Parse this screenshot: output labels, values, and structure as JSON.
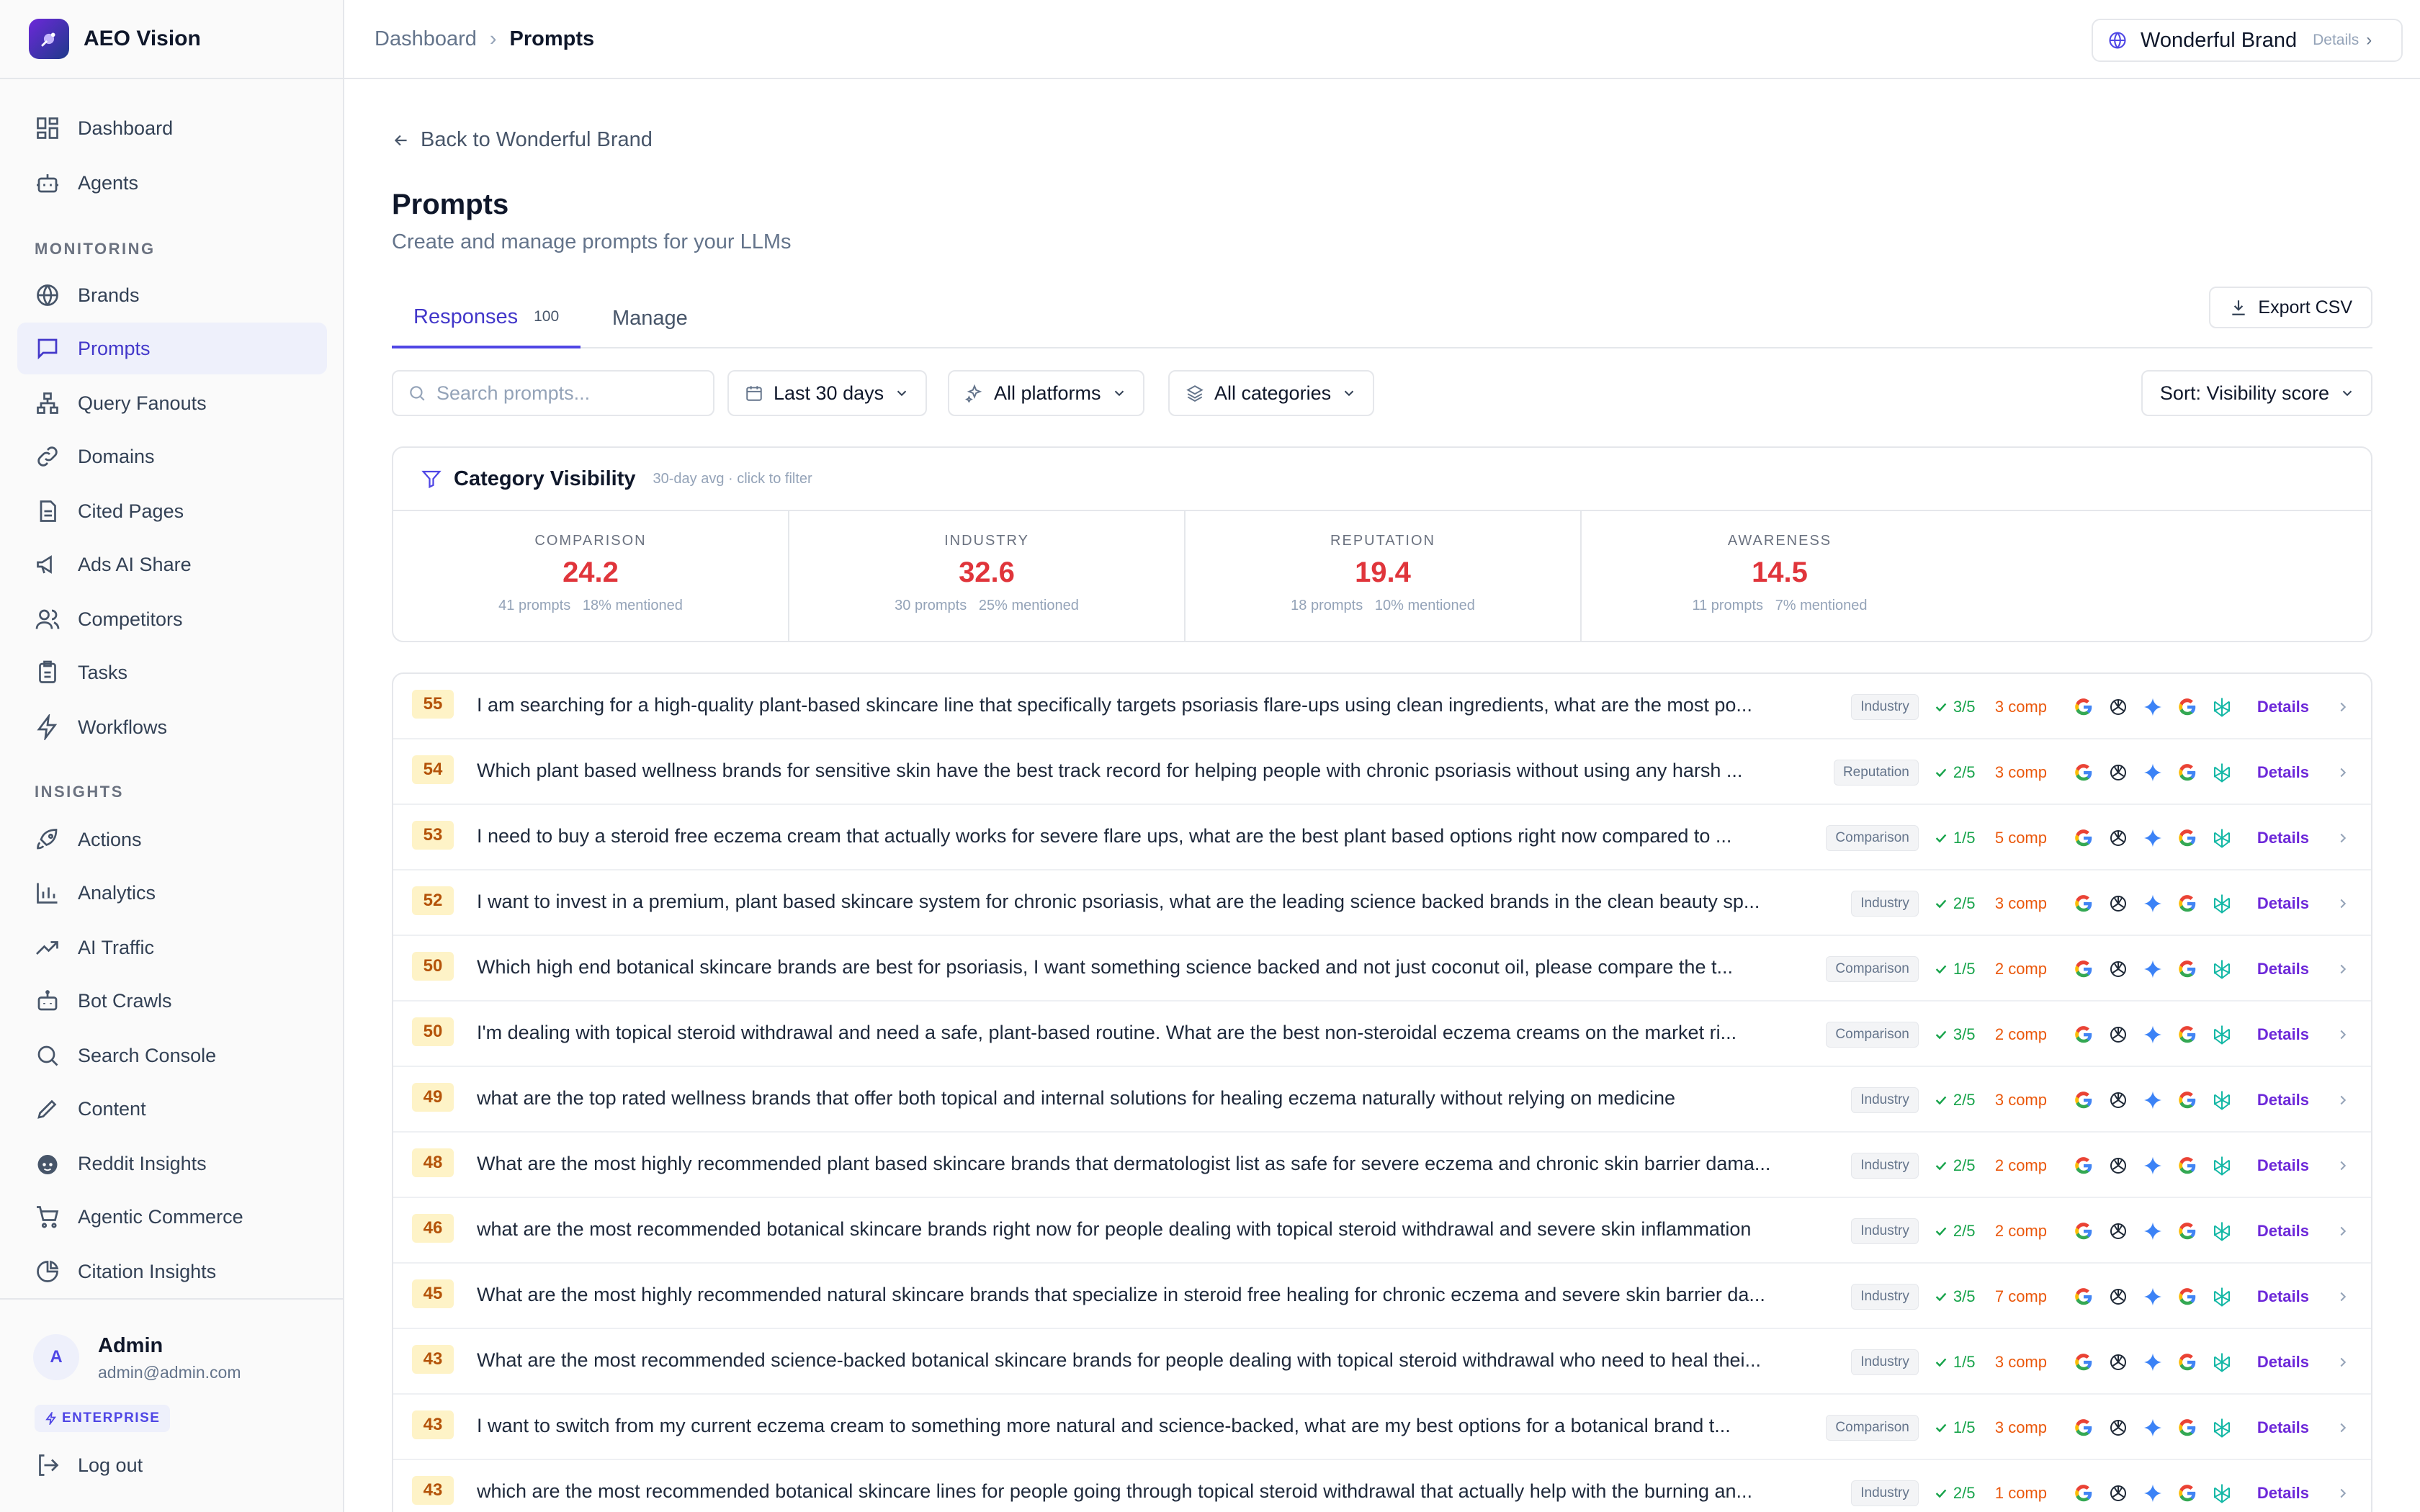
{
  "app": {
    "name": "AEO Vision"
  },
  "sidebar": {
    "top_items": [
      {
        "label": "Dashboard",
        "icon": "dashboard-icon"
      },
      {
        "label": "Agents",
        "icon": "bot-icon"
      }
    ],
    "monitoring_title": "MONITORING",
    "monitoring_items": [
      {
        "label": "Brands",
        "icon": "globe-icon"
      },
      {
        "label": "Prompts",
        "icon": "message-icon",
        "active": true
      },
      {
        "label": "Query Fanouts",
        "icon": "network-icon"
      },
      {
        "label": "Domains",
        "icon": "link-icon"
      },
      {
        "label": "Cited Pages",
        "icon": "file-icon"
      },
      {
        "label": "Ads AI Share",
        "icon": "megaphone-icon"
      },
      {
        "label": "Competitors",
        "icon": "users-icon"
      },
      {
        "label": "Tasks",
        "icon": "clipboard-icon"
      },
      {
        "label": "Workflows",
        "icon": "zap-icon"
      }
    ],
    "insights_title": "INSIGHTS",
    "insights_items": [
      {
        "label": "Actions",
        "icon": "rocket-icon"
      },
      {
        "label": "Analytics",
        "icon": "bar-chart-icon"
      },
      {
        "label": "AI Traffic",
        "icon": "trending-up-icon"
      },
      {
        "label": "Bot Crawls",
        "icon": "robot-icon"
      },
      {
        "label": "Search Console",
        "icon": "search-icon"
      },
      {
        "label": "Content",
        "icon": "pencil-icon"
      },
      {
        "label": "Reddit Insights",
        "icon": "reddit-icon"
      },
      {
        "label": "Agentic Commerce",
        "icon": "cart-icon"
      },
      {
        "label": "Citation Insights",
        "icon": "pie-chart-icon"
      }
    ],
    "user": {
      "initial": "A",
      "name": "Admin",
      "email": "admin@admin.com",
      "plan": "ENTERPRISE"
    },
    "logout_label": "Log out"
  },
  "header": {
    "breadcrumb": [
      "Dashboard",
      "Prompts"
    ],
    "brand": {
      "name": "Wonderful Brand",
      "details_label": "Details"
    }
  },
  "page": {
    "back_label": "Back to Wonderful Brand",
    "title": "Prompts",
    "subtitle": "Create and manage prompts for your LLMs",
    "tabs": [
      {
        "label": "Responses",
        "count": "100",
        "active": true
      },
      {
        "label": "Manage"
      }
    ],
    "export_label": "Export CSV",
    "search_placeholder": "Search prompts...",
    "filters": {
      "date": "Last 30 days",
      "platforms": "All platforms",
      "categories": "All categories",
      "sort": "Sort: Visibility score"
    }
  },
  "category_visibility": {
    "title": "Category Visibility",
    "subtitle": "30-day avg · click to filter",
    "categories": [
      {
        "label": "COMPARISON",
        "value": "24.2",
        "prompts": "41 prompts",
        "mentioned": "18% mentioned"
      },
      {
        "label": "INDUSTRY",
        "value": "32.6",
        "prompts": "30 prompts",
        "mentioned": "25% mentioned"
      },
      {
        "label": "REPUTATION",
        "value": "19.4",
        "prompts": "18 prompts",
        "mentioned": "10% mentioned"
      },
      {
        "label": "AWARENESS",
        "value": "14.5",
        "prompts": "11 prompts",
        "mentioned": "7% mentioned"
      }
    ]
  },
  "prompts": [
    {
      "score": "55",
      "text": "I am searching for a high-quality plant-based skincare line that specifically targets psoriasis flare-ups using clean ingredients, what are the most po...",
      "category": "Industry",
      "visibility": "3/5",
      "comp": "3 comp",
      "details": "Details"
    },
    {
      "score": "54",
      "text": "Which plant based wellness brands for sensitive skin have the best track record for helping people with chronic psoriasis without using any harsh ...",
      "category": "Reputation",
      "visibility": "2/5",
      "comp": "3 comp",
      "details": "Details"
    },
    {
      "score": "53",
      "text": "I need to buy a steroid free eczema cream that actually works for severe flare ups, what are the best plant based options right now compared to ...",
      "category": "Comparison",
      "visibility": "1/5",
      "comp": "5 comp",
      "details": "Details"
    },
    {
      "score": "52",
      "text": "I want to invest in a premium, plant based skincare system for chronic psoriasis, what are the leading science backed brands in the clean beauty sp...",
      "category": "Industry",
      "visibility": "2/5",
      "comp": "3 comp",
      "details": "Details"
    },
    {
      "score": "50",
      "text": "Which high end botanical skincare brands are best for psoriasis, I want something science backed and not just coconut oil, please compare the t...",
      "category": "Comparison",
      "visibility": "1/5",
      "comp": "2 comp",
      "details": "Details"
    },
    {
      "score": "50",
      "text": "I'm dealing with topical steroid withdrawal and need a safe, plant-based routine. What are the best non-steroidal eczema creams on the market ri...",
      "category": "Comparison",
      "visibility": "3/5",
      "comp": "2 comp",
      "details": "Details"
    },
    {
      "score": "49",
      "text": "what are the top rated wellness brands that offer both topical and internal solutions for healing eczema naturally without relying on medicine",
      "category": "Industry",
      "visibility": "2/5",
      "comp": "3 comp",
      "details": "Details"
    },
    {
      "score": "48",
      "text": "What are the most highly recommended plant based skincare brands that dermatologist list as safe for severe eczema and chronic skin barrier dama...",
      "category": "Industry",
      "visibility": "2/5",
      "comp": "2 comp",
      "details": "Details"
    },
    {
      "score": "46",
      "text": "what are the most recommended botanical skincare brands right now for people dealing with topical steroid withdrawal and severe skin inflammation",
      "category": "Industry",
      "visibility": "2/5",
      "comp": "2 comp",
      "details": "Details"
    },
    {
      "score": "45",
      "text": "What are the most highly recommended natural skincare brands that specialize in steroid free healing for chronic eczema and severe skin barrier da...",
      "category": "Industry",
      "visibility": "3/5",
      "comp": "7 comp",
      "details": "Details"
    },
    {
      "score": "43",
      "text": "What are the most recommended science-backed botanical skincare brands for people dealing with topical steroid withdrawal who need to heal thei...",
      "category": "Industry",
      "visibility": "1/5",
      "comp": "3 comp",
      "details": "Details"
    },
    {
      "score": "43",
      "text": "I want to switch from my current eczema cream to something more natural and science-backed, what are my best options for a botanical brand t...",
      "category": "Comparison",
      "visibility": "1/5",
      "comp": "3 comp",
      "details": "Details"
    },
    {
      "score": "43",
      "text": "which are the most recommended botanical skincare lines for people going through topical steroid withdrawal that actually help with the burning an...",
      "category": "Industry",
      "visibility": "2/5",
      "comp": "1 comp",
      "details": "Details"
    }
  ]
}
